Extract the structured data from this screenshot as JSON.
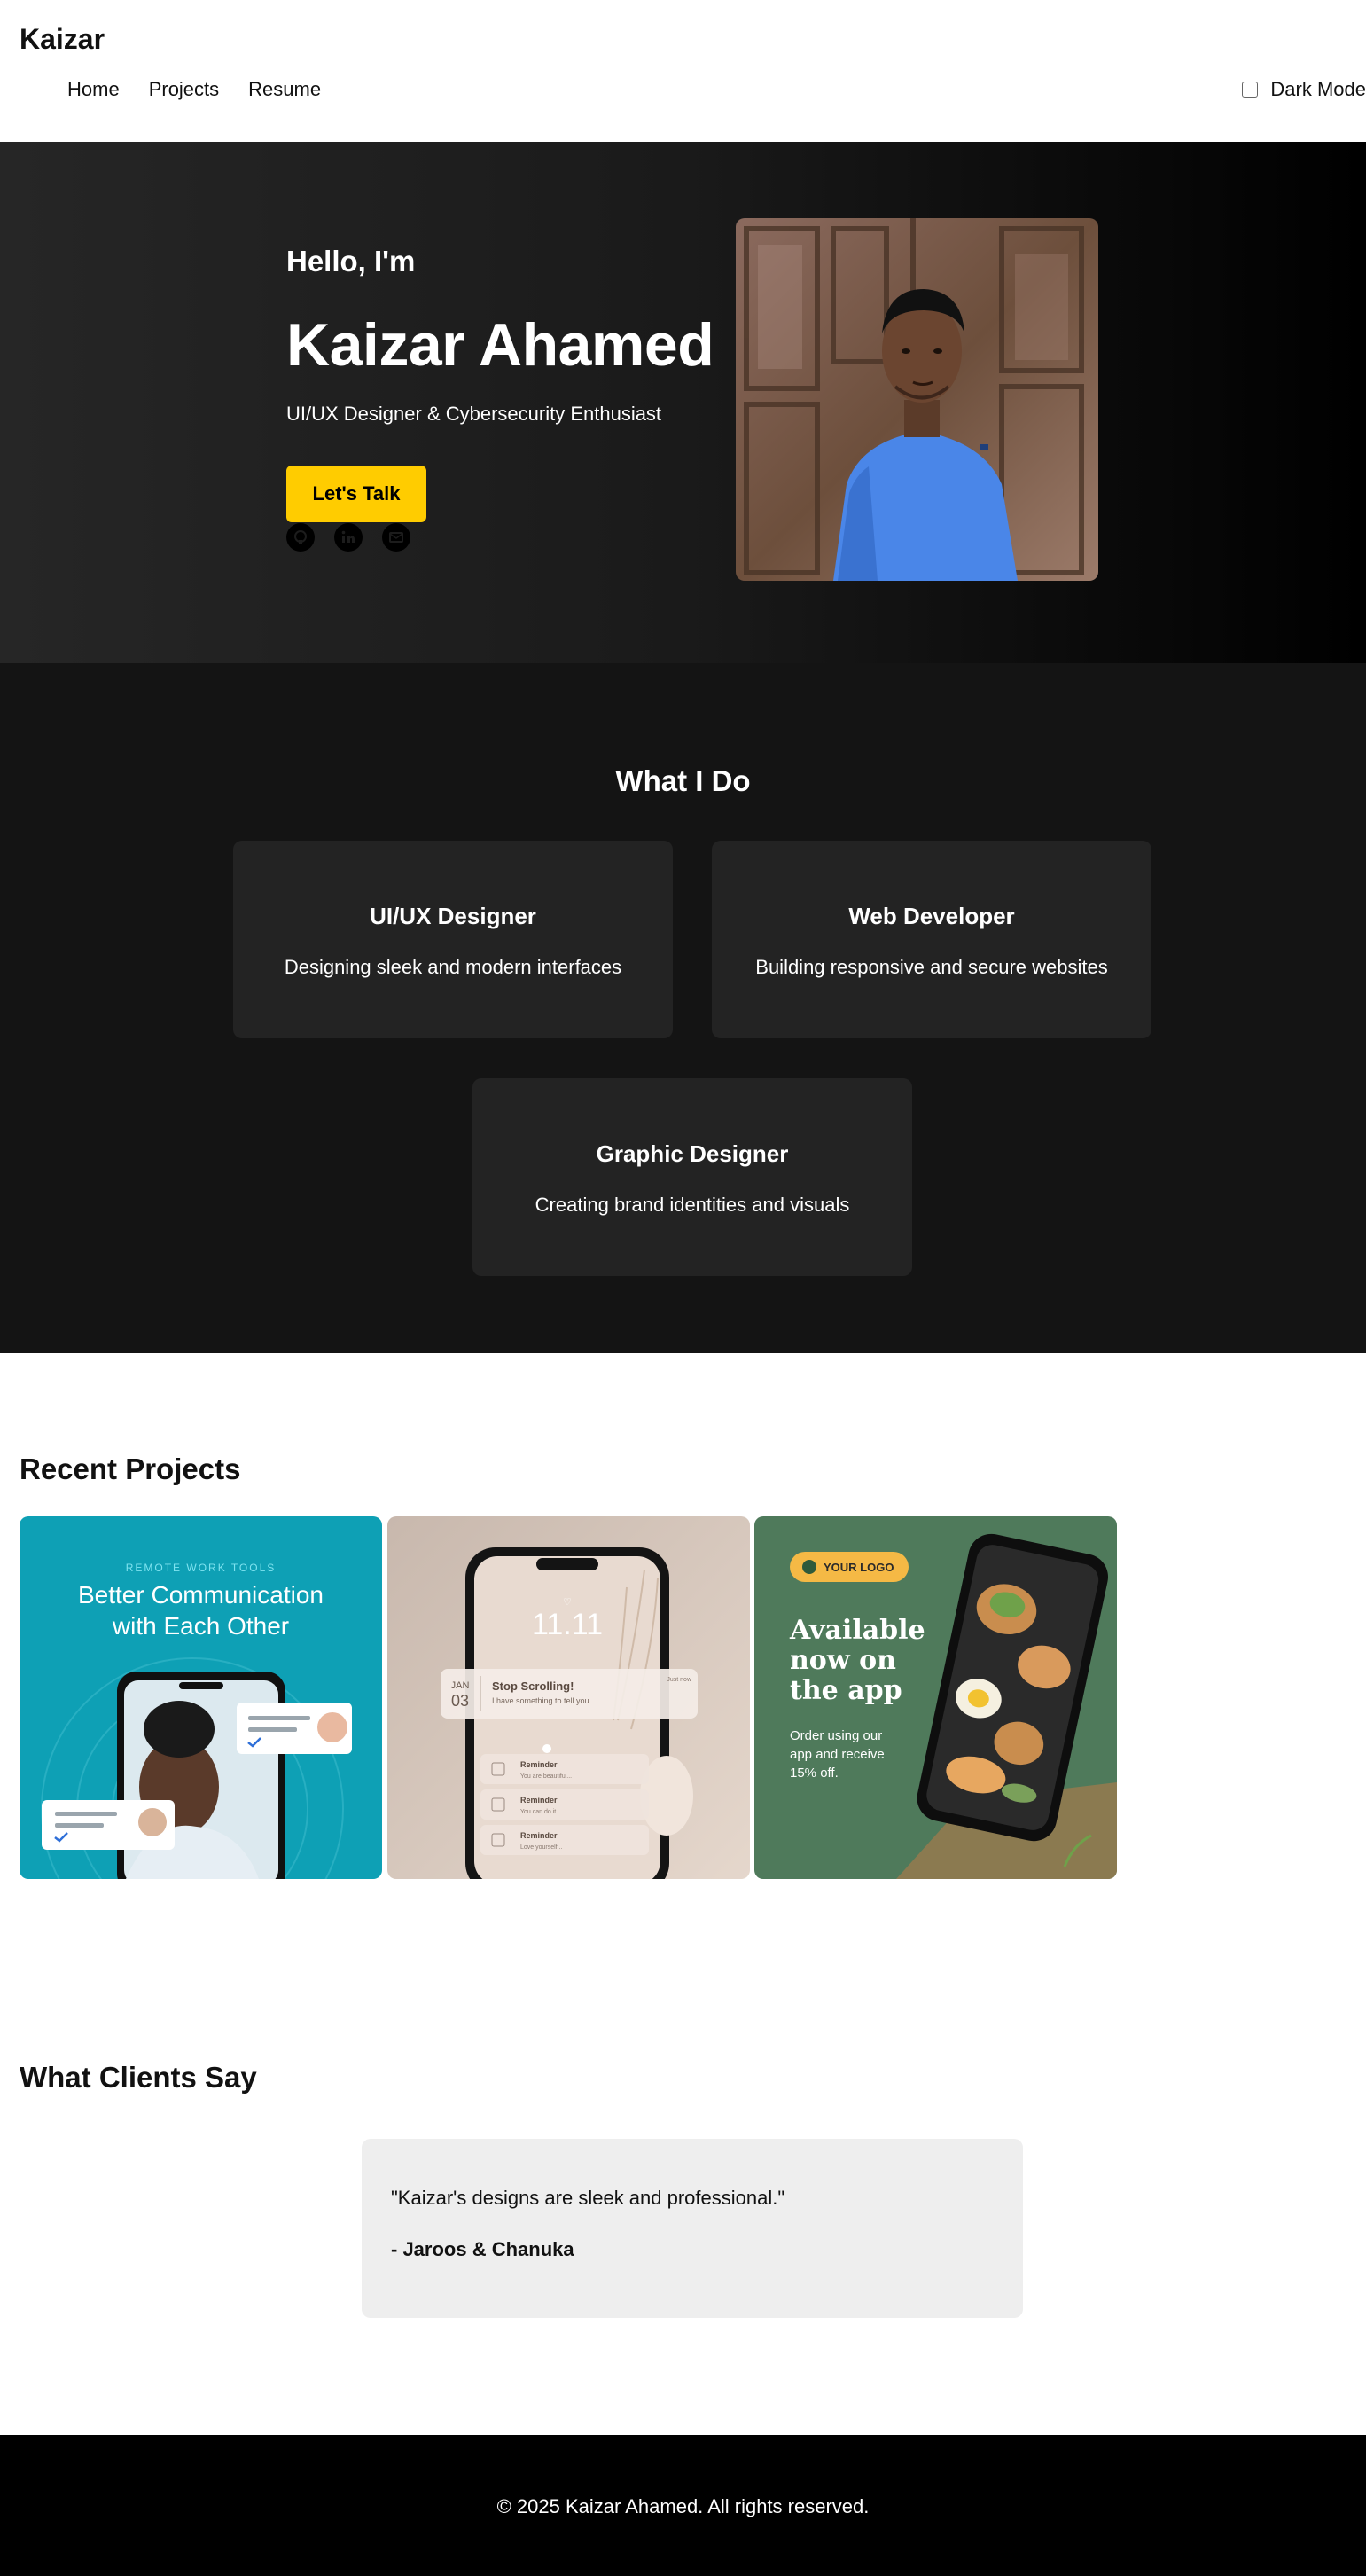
{
  "header": {
    "brand": "Kaizar",
    "nav": [
      "Home",
      "Projects",
      "Resume"
    ],
    "dark_mode_label": "Dark Mode",
    "dark_mode_checked": false
  },
  "hero": {
    "greeting": "Hello, I'm",
    "name": "Kaizar Ahamed",
    "subtitle": "UI/UX Designer & Cybersecurity Enthusiast",
    "cta_label": "Let's Talk",
    "socials": [
      "github-icon",
      "linkedin-icon",
      "email-icon"
    ]
  },
  "services": {
    "title": "What I Do",
    "cards": [
      {
        "title": "UI/UX Designer",
        "desc": "Designing sleek and modern interfaces"
      },
      {
        "title": "Web Developer",
        "desc": "Building responsive and secure websites"
      },
      {
        "title": "Graphic Designer",
        "desc": "Creating brand identities and visuals"
      }
    ]
  },
  "projects": {
    "title": "Recent Projects",
    "items": [
      {
        "tag": "REMOTE WORK TOOLS",
        "headline_1": "Better Communication",
        "headline_2": "with Each Other",
        "bg": "#0ea0b5"
      },
      {
        "time": "11.11",
        "month": "JAN",
        "day": "03",
        "notif_title": "Stop Scrolling!",
        "notif_body": "I have something to tell you",
        "notif_meta": "Just now",
        "reminders": [
          {
            "title": "Reminder",
            "body": "You are beautiful..."
          },
          {
            "title": "Reminder",
            "body": "You can do it..."
          },
          {
            "title": "Reminder",
            "body": "Love yourself..."
          }
        ],
        "bg": "#d8c8bd"
      },
      {
        "logo": "YOUR LOGO",
        "headline_1": "Available",
        "headline_2": "now on",
        "headline_3": "the app",
        "body_1": "Order using our",
        "body_2": "app and receive",
        "body_3": "15% off.",
        "bg": "#4f7a5b",
        "accent": "#f5b945"
      }
    ]
  },
  "testimonials": {
    "title": "What Clients Say",
    "quote": "\"Kaizar's designs are sleek and professional.\"",
    "author": "- Jaroos & Chanuka"
  },
  "footer": {
    "copyright": "© 2025 Kaizar Ahamed. All rights reserved."
  },
  "colors": {
    "accent": "#ffcc00",
    "services_bg": "#141414",
    "card_bg": "#232323",
    "testimonial_bg": "#eeeeee"
  }
}
